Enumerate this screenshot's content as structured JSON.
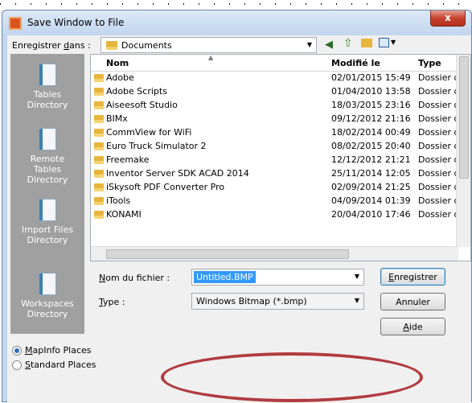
{
  "window": {
    "title": "Save Window to File",
    "close_label": "x"
  },
  "location": {
    "label": "Enregistrer dans :",
    "label_u": "d",
    "value": "Documents"
  },
  "places": [
    {
      "line1": "Tables",
      "line2": "Directory"
    },
    {
      "line1": "Remote",
      "line2": "Tables",
      "line3": "Directory"
    },
    {
      "line1": "Import Files",
      "line2": "Directory"
    },
    {
      "line1": "Workspaces",
      "line2": "Directory"
    }
  ],
  "columns": {
    "name": "Nom",
    "modified": "Modifié le",
    "type": "Type"
  },
  "files": [
    {
      "name": "Adobe",
      "date": "02/01/2015 15:49",
      "type": "Dossier d"
    },
    {
      "name": "Adobe Scripts",
      "date": "01/04/2010 13:58",
      "type": "Dossier d"
    },
    {
      "name": "Aiseesoft Studio",
      "date": "18/03/2015 23:16",
      "type": "Dossier d"
    },
    {
      "name": "BIMx",
      "date": "09/12/2012 21:16",
      "type": "Dossier d"
    },
    {
      "name": "CommView for WiFi",
      "date": "18/02/2014 00:49",
      "type": "Dossier d"
    },
    {
      "name": "Euro Truck Simulator 2",
      "date": "08/02/2015 20:40",
      "type": "Dossier d"
    },
    {
      "name": "Freemake",
      "date": "12/12/2012 21:21",
      "type": "Dossier d"
    },
    {
      "name": "Inventor Server SDK ACAD 2014",
      "date": "25/11/2014 12:05",
      "type": "Dossier d"
    },
    {
      "name": "iSkysoft PDF Converter Pro",
      "date": "02/09/2014 21:25",
      "type": "Dossier d"
    },
    {
      "name": "iTools",
      "date": "04/09/2014 01:39",
      "type": "Dossier d"
    },
    {
      "name": "KONAMI",
      "date": "20/04/2010 17:46",
      "type": "Dossier d"
    }
  ],
  "filename": {
    "label": "Nom du fichier :",
    "value": "Untitled.BMP"
  },
  "filetype": {
    "label": "Type :",
    "value": "Windows Bitmap (*.bmp)"
  },
  "buttons": {
    "save": "Enregistrer",
    "cancel": "Annuler",
    "help": "Aide"
  },
  "radios": {
    "mapinfo": "MapInfo Places",
    "standard": "Standard Places",
    "selected": "mapinfo"
  },
  "colors": {
    "annotation": "#b13b3e",
    "places_panel": "#a0a0a0",
    "selection": "#3399ff"
  }
}
